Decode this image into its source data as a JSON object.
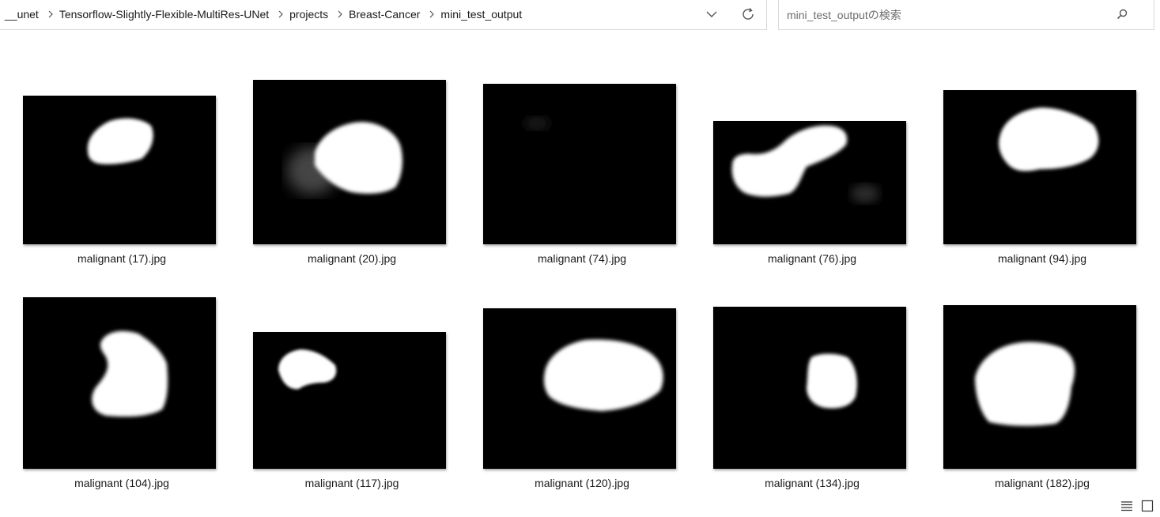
{
  "breadcrumbs": [
    "__unet",
    "Tensorflow-Slightly-Flexible-MultiRes-UNet",
    "projects",
    "Breast-Cancer",
    "mini_test_output"
  ],
  "search": {
    "placeholder": "mini_test_outputの検索"
  },
  "icons": {
    "separator": "chevron-right-icon",
    "dropdown": "chevron-down-icon",
    "refresh": "refresh-icon",
    "search": "search-icon",
    "details_view": "details-view-icon",
    "thumbnail_view": "large-icons-view-icon"
  },
  "files": [
    {
      "name": "malignant (17).jpg"
    },
    {
      "name": "malignant (20).jpg"
    },
    {
      "name": "malignant (74).jpg"
    },
    {
      "name": "malignant (76).jpg"
    },
    {
      "name": "malignant (94).jpg"
    },
    {
      "name": "malignant (104).jpg"
    },
    {
      "name": "malignant (117).jpg"
    },
    {
      "name": "malignant (120).jpg"
    },
    {
      "name": "malignant (134).jpg"
    },
    {
      "name": "malignant (182).jpg"
    }
  ]
}
